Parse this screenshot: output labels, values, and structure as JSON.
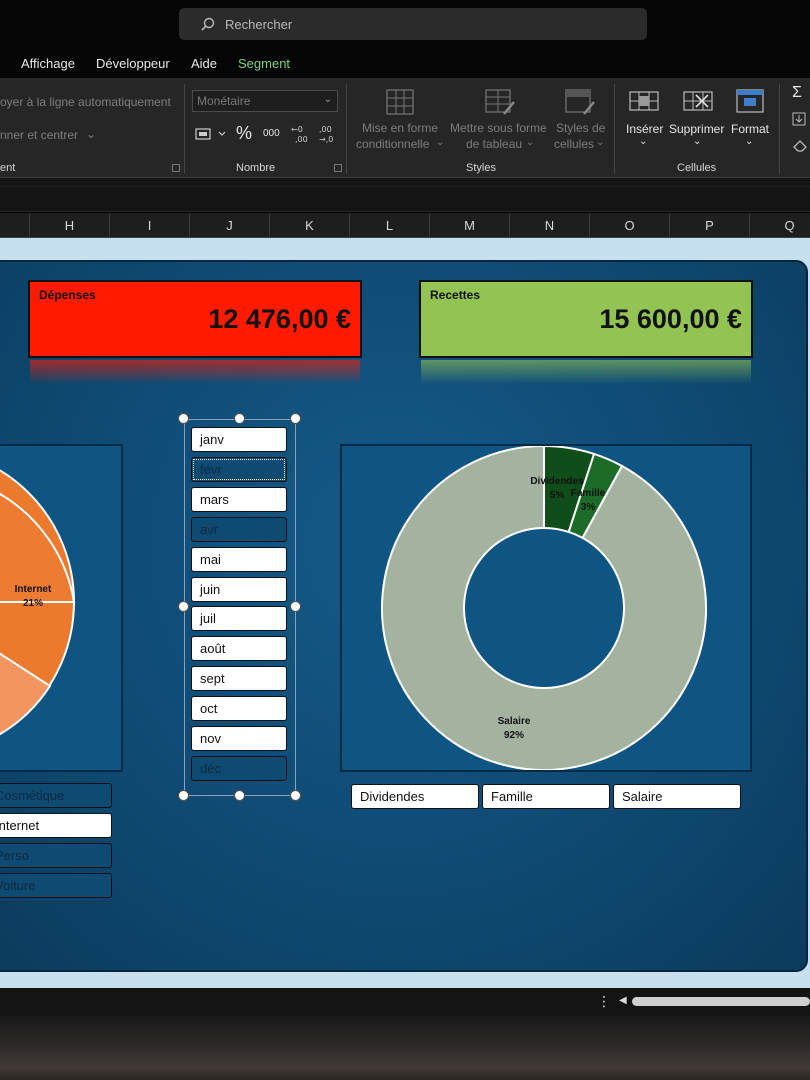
{
  "titlebar": {
    "search_placeholder": "Rechercher"
  },
  "menu": {
    "affichage": "Affichage",
    "developpeur": "Développeur",
    "aide": "Aide",
    "segment": "Segment"
  },
  "ribbon": {
    "renvoyer": "oyer à la ligne automatiquement",
    "fusionner": "nner et centrer",
    "group_alignement": "ent",
    "number_format": "Monétaire",
    "group_nombre": "Nombre",
    "mise_forme_1": "Mise en forme",
    "mise_forme_2": "conditionnelle",
    "tableau_1": "Mettre sous forme",
    "tableau_2": "de tableau",
    "styles_cell_1": "Styles de",
    "styles_cell_2": "cellules",
    "group_styles": "Styles",
    "inserer": "Insérer",
    "supprimer": "Supprimer",
    "format": "Format",
    "group_cellules": "Cellules"
  },
  "columns": [
    "H",
    "I",
    "J",
    "K",
    "L",
    "M",
    "N",
    "O",
    "P",
    "Q"
  ],
  "kpis": {
    "depenses": {
      "label": "Dépenses",
      "value": "12 476,00 €",
      "color": "#ff1a00"
    },
    "recettes": {
      "label": "Recettes",
      "value": "15 600,00 €",
      "color": "#92c353"
    }
  },
  "months": [
    {
      "label": "janv",
      "selected": true
    },
    {
      "label": "févr",
      "selected": false
    },
    {
      "label": "mars",
      "selected": true
    },
    {
      "label": "avr",
      "selected": false
    },
    {
      "label": "mai",
      "selected": true
    },
    {
      "label": "juin",
      "selected": true
    },
    {
      "label": "juil",
      "selected": true
    },
    {
      "label": "août",
      "selected": true
    },
    {
      "label": "sept",
      "selected": true
    },
    {
      "label": "oct",
      "selected": true
    },
    {
      "label": "nov",
      "selected": true
    },
    {
      "label": "déc",
      "selected": false
    }
  ],
  "expense_categories": [
    {
      "label": "Cosmétique",
      "selected": false
    },
    {
      "label": "Internet",
      "selected": true
    },
    {
      "label": "Perso",
      "selected": false
    },
    {
      "label": "Voiture",
      "selected": false
    }
  ],
  "income_categories": [
    {
      "label": "Dividendes",
      "selected": true
    },
    {
      "label": "Famille",
      "selected": true
    },
    {
      "label": "Salaire",
      "selected": true
    }
  ],
  "expense_pie_visible_label": {
    "name": "Internet",
    "pct": "21%"
  },
  "chart_data": {
    "type": "pie",
    "doughnut": true,
    "categories": [
      "Dividendes",
      "Famille",
      "Salaire"
    ],
    "values": [
      5,
      3,
      92
    ],
    "labels": [
      "5%",
      "3%",
      "92%"
    ],
    "colors": [
      "#0f4d1a",
      "#1c6b28",
      "#a3b3a0"
    ]
  }
}
